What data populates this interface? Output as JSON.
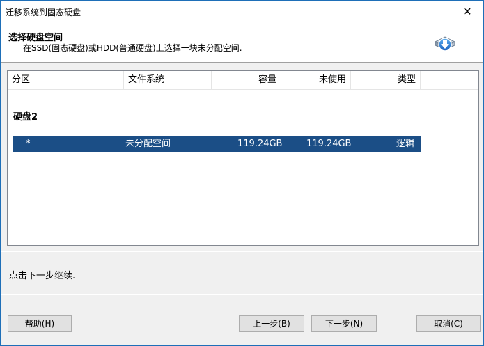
{
  "window": {
    "title": "迁移系统到固态硬盘",
    "close_glyph": "✕"
  },
  "header": {
    "title": "选择硬盘空间",
    "subtitle": "在SSD(固态硬盘)或HDD(普通硬盘)上选择一块未分配空间.",
    "icon": "disk-download-icon"
  },
  "table": {
    "columns": [
      "分区",
      "文件系统",
      "容量",
      "未使用",
      "类型",
      ""
    ],
    "groups": [
      {
        "label": "硬盘2",
        "rows": [
          {
            "partition": "*",
            "filesystem": "未分配空间",
            "capacity": "119.24GB",
            "unused": "119.24GB",
            "type": "逻辑",
            "selected": true
          }
        ]
      }
    ]
  },
  "status": {
    "text": "点击下一步继续."
  },
  "buttons": {
    "help": "帮助(H)",
    "prev": "上一步(B)",
    "next": "下一步(N)",
    "cancel": "取消(C)"
  },
  "colors": {
    "selection": "#1b4e86",
    "window_border": "#1e6fb8",
    "dialog_bg": "#f0f0f0"
  }
}
